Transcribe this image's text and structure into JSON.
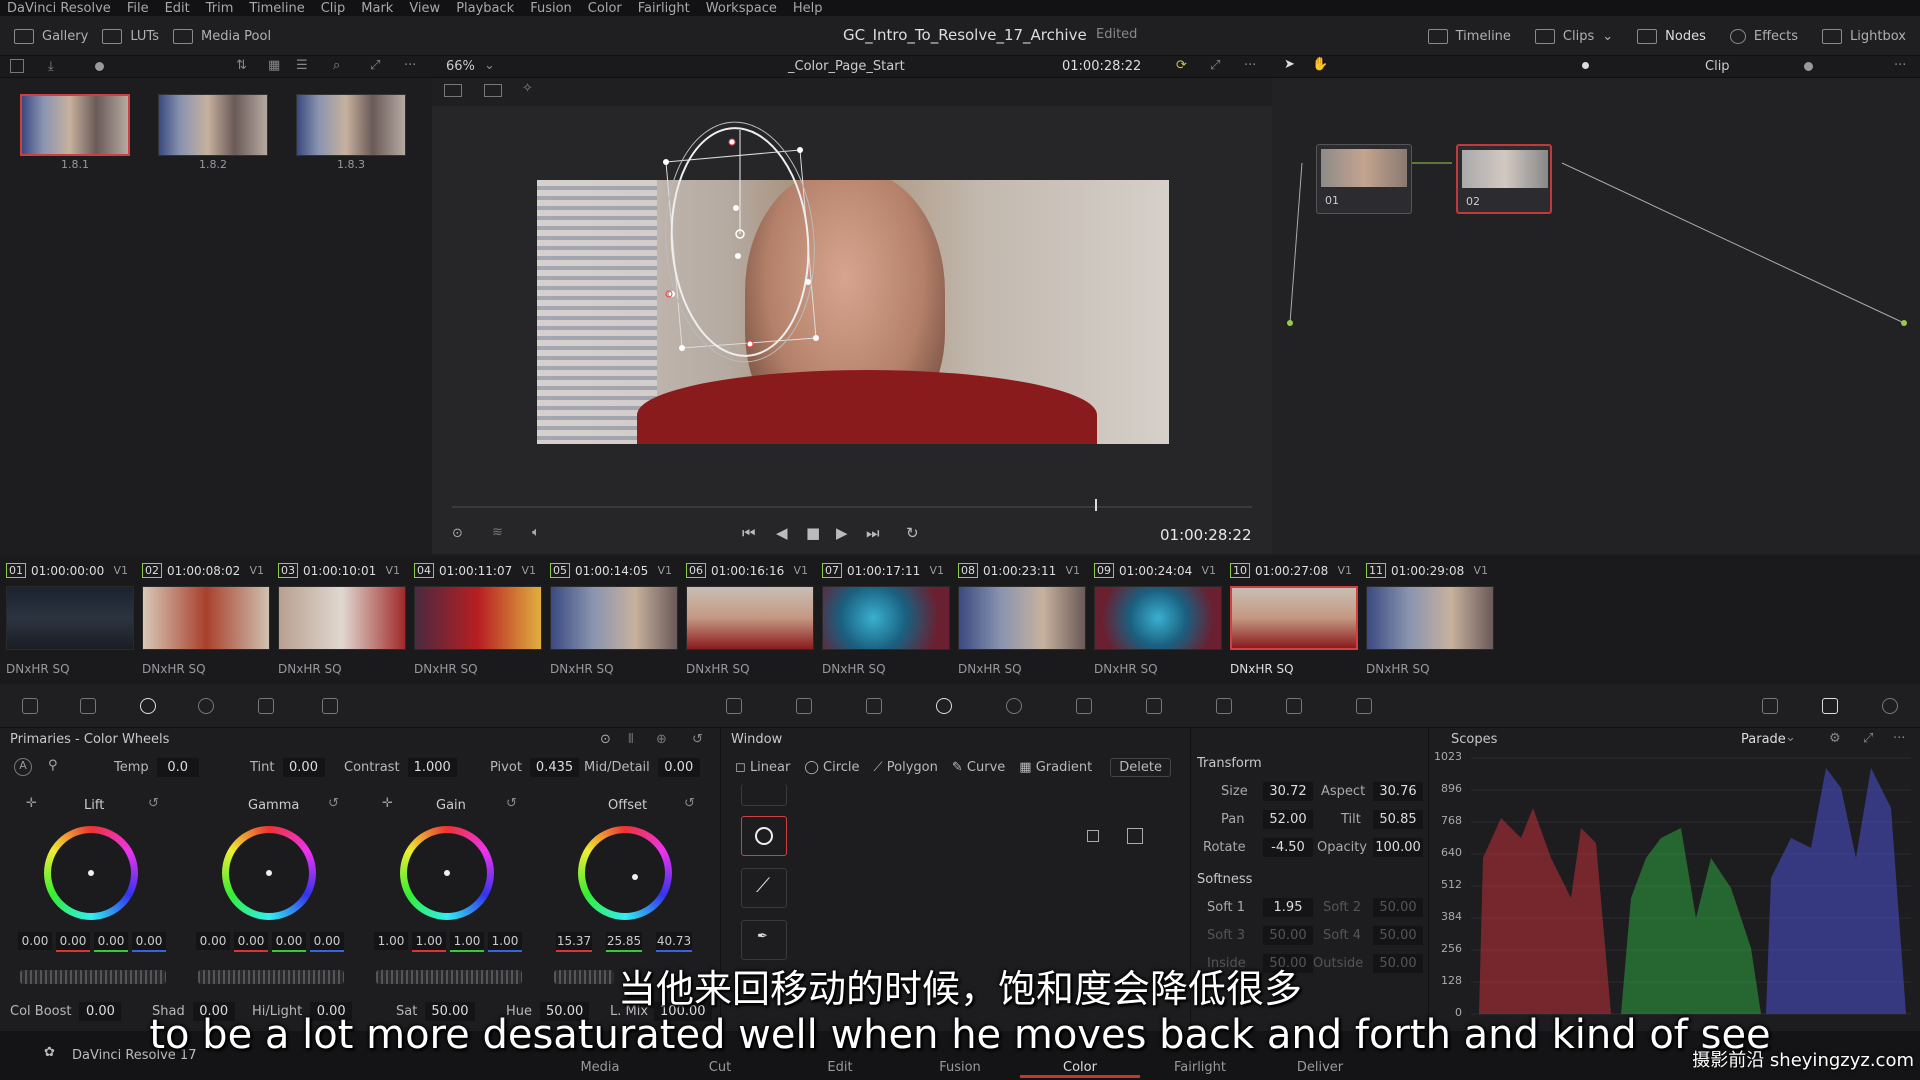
{
  "menu": [
    "DaVinci Resolve",
    "File",
    "Edit",
    "Trim",
    "Timeline",
    "Clip",
    "Mark",
    "View",
    "Playback",
    "Fusion",
    "Color",
    "Fairlight",
    "Workspace",
    "Help"
  ],
  "top": {
    "gallery": "Gallery",
    "luts": "LUTs",
    "media_pool": "Media Pool",
    "project": "GC_Intro_To_Resolve_17_Archive",
    "status": "Edited",
    "timeline": "Timeline",
    "clips": "Clips",
    "nodes": "Nodes",
    "effects": "Effects",
    "lightbox": "Lightbox"
  },
  "viewer_bar": {
    "zoom": "66%",
    "timeline_name": "_Color_Page_Start",
    "timecode": "01:00:28:22",
    "mode": "Clip"
  },
  "stills": [
    "1.8.1",
    "1.8.2",
    "1.8.3"
  ],
  "transport": {
    "timecode": "01:00:28:22"
  },
  "node_labels": [
    "01",
    "02"
  ],
  "clips": [
    {
      "num": "01",
      "tc": "01:00:00:00",
      "track": "V1",
      "codec": "DNxHR SQ"
    },
    {
      "num": "02",
      "tc": "01:00:08:02",
      "track": "V1",
      "codec": "DNxHR SQ"
    },
    {
      "num": "03",
      "tc": "01:00:10:01",
      "track": "V1",
      "codec": "DNxHR SQ"
    },
    {
      "num": "04",
      "tc": "01:00:11:07",
      "track": "V1",
      "codec": "DNxHR SQ"
    },
    {
      "num": "05",
      "tc": "01:00:14:05",
      "track": "V1",
      "codec": "DNxHR SQ"
    },
    {
      "num": "06",
      "tc": "01:00:16:16",
      "track": "V1",
      "codec": "DNxHR SQ"
    },
    {
      "num": "07",
      "tc": "01:00:17:11",
      "track": "V1",
      "codec": "DNxHR SQ"
    },
    {
      "num": "08",
      "tc": "01:00:23:11",
      "track": "V1",
      "codec": "DNxHR SQ"
    },
    {
      "num": "09",
      "tc": "01:00:24:04",
      "track": "V1",
      "codec": "DNxHR SQ"
    },
    {
      "num": "10",
      "tc": "01:00:27:08",
      "track": "V1",
      "codec": "DNxHR SQ"
    },
    {
      "num": "11",
      "tc": "01:00:29:08",
      "track": "V1",
      "codec": "DNxHR SQ"
    }
  ],
  "primaries": {
    "title": "Primaries - Color Wheels",
    "temp_label": "Temp",
    "temp": "0.0",
    "tint_label": "Tint",
    "tint": "0.00",
    "contrast_label": "Contrast",
    "contrast": "1.000",
    "pivot_label": "Pivot",
    "pivot": "0.435",
    "middetail_label": "Mid/Detail",
    "middetail": "0.00",
    "wheels": [
      {
        "name": "Lift",
        "values": [
          "0.00",
          "0.00",
          "0.00",
          "0.00"
        ]
      },
      {
        "name": "Gamma",
        "values": [
          "0.00",
          "0.00",
          "0.00",
          "0.00"
        ]
      },
      {
        "name": "Gain",
        "values": [
          "1.00",
          "1.00",
          "1.00",
          "1.00"
        ]
      },
      {
        "name": "Offset",
        "values": [
          "15.37",
          "25.85",
          "40.73"
        ]
      }
    ],
    "colboost_label": "Col Boost",
    "colboost": "0.00",
    "shad_label": "Shad",
    "shad": "0.00",
    "hilight_label": "Hi/Light",
    "hilight": "0.00",
    "sat_label": "Sat",
    "sat": "50.00",
    "hue_label": "Hue",
    "hue": "50.00",
    "lmix_label": "L. Mix",
    "lmix": "100.00"
  },
  "window": {
    "title": "Window",
    "tools": [
      "Linear",
      "Circle",
      "Polygon",
      "Curve",
      "Gradient"
    ],
    "delete": "Delete"
  },
  "transform": {
    "title": "Transform",
    "size_label": "Size",
    "size": "30.72",
    "aspect_label": "Aspect",
    "aspect": "30.76",
    "pan_label": "Pan",
    "pan": "52.00",
    "tilt_label": "Tilt",
    "tilt": "50.85",
    "rotate_label": "Rotate",
    "rotate": "-4.50",
    "opacity_label": "Opacity",
    "opacity": "100.00",
    "softness_title": "Softness",
    "soft1_label": "Soft 1",
    "soft1": "1.95",
    "soft2_label": "Soft 2",
    "soft2": "50.00",
    "soft3_label": "Soft 3",
    "soft3": "50.00",
    "soft4_label": "Soft 4",
    "soft4": "50.00",
    "inside_label": "Inside",
    "inside": "50.00",
    "outside_label": "Outside",
    "outside": "50.00"
  },
  "scopes": {
    "title": "Scopes",
    "mode": "Parade",
    "y_ticks": [
      "1023",
      "896",
      "768",
      "640",
      "512",
      "384",
      "256",
      "128",
      "0"
    ]
  },
  "pages": [
    "Media",
    "Cut",
    "Edit",
    "Fusion",
    "Color",
    "Fairlight",
    "Deliver"
  ],
  "active_page": "Color",
  "app_name": "DaVinci Resolve 17",
  "subtitle_cn": "当他来回移动的时候，饱和度会降低很多",
  "subtitle_en": "to be a lot more desaturated well when he moves back and forth and kind of see",
  "watermark": "摄影前沿 sheyingzyz.com",
  "colors": {
    "accent_red": "#d04040",
    "bg": "#1c1c1e"
  }
}
